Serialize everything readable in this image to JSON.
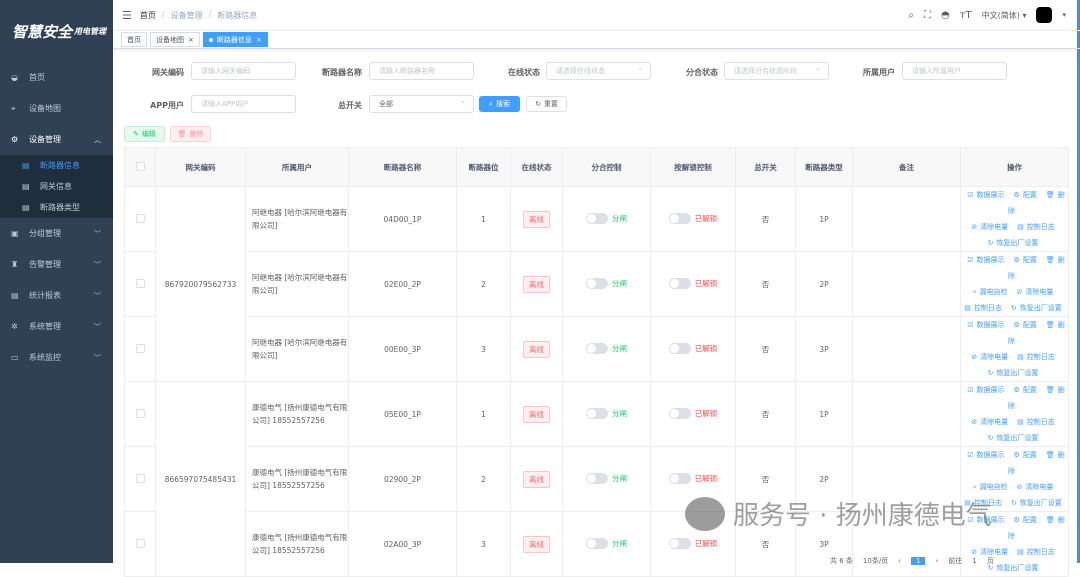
{
  "logo": {
    "title": "智慧安全",
    "subtitle": "用电管理"
  },
  "sidebar": {
    "items": [
      {
        "label": "首页",
        "icon": "dashboard-icon"
      },
      {
        "label": "设备地图",
        "icon": "map-icon"
      },
      {
        "label": "设备管理",
        "icon": "settings-icon",
        "open": true,
        "children": [
          {
            "label": "断路器信息",
            "active": true
          },
          {
            "label": "网关信息"
          },
          {
            "label": "断路器类型"
          }
        ]
      },
      {
        "label": "分组管理",
        "icon": "group-icon"
      },
      {
        "label": "告警管理",
        "icon": "alarm-icon"
      },
      {
        "label": "统计报表",
        "icon": "chart-icon"
      },
      {
        "label": "系统管理",
        "icon": "system-icon"
      },
      {
        "label": "系统监控",
        "icon": "monitor-icon"
      }
    ]
  },
  "header": {
    "breadcrumb": [
      "首页",
      "设备管理",
      "断路器信息"
    ],
    "language": "中文(简体)"
  },
  "tags": [
    {
      "label": "首页"
    },
    {
      "label": "设备地图"
    },
    {
      "label": "断路器信息",
      "active": true
    }
  ],
  "filters": {
    "gateway_code": {
      "label": "网关编码",
      "placeholder": "请输入网关编码"
    },
    "breaker_name": {
      "label": "断路器名称",
      "placeholder": "请输入断路器名称"
    },
    "online_status": {
      "label": "在线状态",
      "placeholder": "请选择在线状态"
    },
    "switch_status": {
      "label": "分合状态",
      "placeholder": "请选择分合状态阶段"
    },
    "owner": {
      "label": "所属用户",
      "placeholder": "请输入所属用户"
    },
    "app_user": {
      "label": "APP用户",
      "placeholder": "请输入APP用户"
    },
    "main_switch": {
      "label": "总开关",
      "value": "全部"
    },
    "search": "搜索",
    "reset": "重置"
  },
  "toolbar": {
    "edit": "编辑",
    "delete": "删除"
  },
  "table": {
    "headers": [
      "网关编码",
      "所属用户",
      "断路器名称",
      "断路器位",
      "在线状态",
      "分合控制",
      "按解锁控制",
      "总开关",
      "断路器类型",
      "备注",
      "操作"
    ],
    "groups": [
      {
        "gateway": "867920079562733",
        "rows": [
          {
            "user": "阿继电器 [哈尔滨阿继电器有限公司]",
            "name": "04D00_1P",
            "pos": "1",
            "status": "离线",
            "switch": "分闸",
            "lock": "已解锁",
            "main": "否",
            "type": "1P",
            "note": "",
            "ops": [
              [
                "数据展示",
                "配置",
                "删除"
              ],
              [
                "清除电量",
                "控制日志"
              ],
              [
                "恢复出厂设置"
              ]
            ]
          },
          {
            "user": "阿继电器 [哈尔滨阿继电器有限公司]",
            "name": "02E00_2P",
            "pos": "2",
            "status": "离线",
            "switch": "分闸",
            "lock": "已解锁",
            "main": "否",
            "type": "2P",
            "note": "",
            "ops": [
              [
                "数据展示",
                "配置",
                "删除"
              ],
              [
                "漏电自检",
                "清除电量"
              ],
              [
                "控制日志",
                "恢复出厂设置"
              ]
            ]
          },
          {
            "user": "阿继电器 [哈尔滨阿继电器有限公司]",
            "name": "00E00_3P",
            "pos": "3",
            "status": "离线",
            "switch": "分闸",
            "lock": "已解锁",
            "main": "否",
            "type": "3P",
            "note": "",
            "ops": [
              [
                "数据展示",
                "配置",
                "删除"
              ],
              [
                "清除电量",
                "控制日志"
              ],
              [
                "恢复出厂设置"
              ]
            ]
          }
        ]
      },
      {
        "gateway": "866597075485431",
        "rows": [
          {
            "user": "康德电气 [扬州康德电气有限公司] 18552557256",
            "name": "05E00_1P",
            "pos": "1",
            "status": "离线",
            "switch": "分闸",
            "lock": "已解锁",
            "main": "否",
            "type": "1P",
            "note": "",
            "ops": [
              [
                "数据展示",
                "配置",
                "删除"
              ],
              [
                "清除电量",
                "控制日志"
              ],
              [
                "恢复出厂设置"
              ]
            ]
          },
          {
            "user": "康德电气 [扬州康德电气有限公司] 18552557256",
            "name": "02900_2P",
            "pos": "2",
            "status": "离线",
            "switch": "分闸",
            "lock": "已解锁",
            "main": "否",
            "type": "2P",
            "note": "",
            "ops": [
              [
                "数据展示",
                "配置",
                "删除"
              ],
              [
                "漏电自检",
                "清除电量"
              ],
              [
                "控制日志",
                "恢复出厂设置"
              ]
            ]
          },
          {
            "user": "康德电气 [扬州康德电气有限公司] 18552557256",
            "name": "02A00_3P",
            "pos": "3",
            "status": "离线",
            "switch": "分闸",
            "lock": "已解锁",
            "main": "否",
            "type": "3P",
            "note": "",
            "ops": [
              [
                "数据展示",
                "配置",
                "删除"
              ],
              [
                "清除电量",
                "控制日志"
              ],
              [
                "恢复出厂设置"
              ]
            ]
          }
        ]
      }
    ]
  },
  "pagination": {
    "total": "共 6 条",
    "page_size": "10条/页",
    "current": "1",
    "goto": "前往",
    "goto_value": "1",
    "page_unit": "页"
  },
  "watermark": "服务号 · 扬州康德电气"
}
